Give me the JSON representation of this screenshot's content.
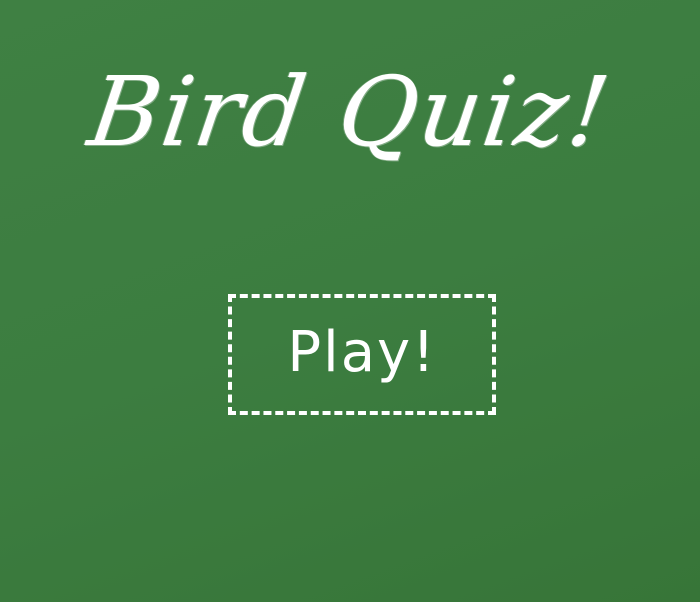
{
  "game": {
    "title": "Bird Quiz!",
    "play_label": "Play!"
  },
  "colors": {
    "background": "#3c7d40",
    "chalk": "#ffffff"
  }
}
